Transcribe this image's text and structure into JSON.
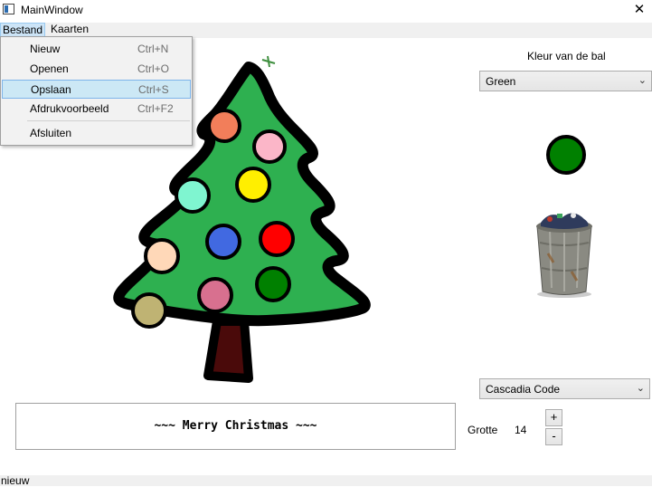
{
  "window": {
    "title": "MainWindow",
    "close_glyph": "✕"
  },
  "menubar": {
    "items": [
      {
        "label": "Bestand"
      },
      {
        "label": "Kaarten"
      }
    ]
  },
  "file_menu": {
    "items": [
      {
        "label": "Nieuw",
        "shortcut": "Ctrl+N"
      },
      {
        "label": "Openen",
        "shortcut": "Ctrl+O"
      },
      {
        "label": "Opslaan",
        "shortcut": "Ctrl+S",
        "highlighted": true
      },
      {
        "label": "Afdrukvoorbeeld",
        "shortcut": "Ctrl+F2"
      },
      {
        "label": "Afsluiten",
        "shortcut": ""
      }
    ]
  },
  "canvas": {
    "tree": {
      "fill": "#2eb050",
      "outline": "#000000",
      "trunk": "#4a0a0a",
      "star": "#3e8e3e"
    },
    "balls": [
      {
        "color": "#f27e5a"
      },
      {
        "color": "#fbb6c8"
      },
      {
        "color": "#7ff5d0"
      },
      {
        "color": "#ffef00"
      },
      {
        "color": "#ffd8b8"
      },
      {
        "color": "#4169e1"
      },
      {
        "color": "#ff0000"
      },
      {
        "color": "#d8708f"
      },
      {
        "color": "#008000"
      },
      {
        "color": "#bfb373"
      }
    ]
  },
  "ball_color": {
    "label": "Kleur van de bal",
    "selected": "Green",
    "swatch": "#008000"
  },
  "trash_icon": "trash-can-icon",
  "font_selector": {
    "selected": "Cascadia Code"
  },
  "greeting": {
    "text": "~~~ Merry Christmas ~~~"
  },
  "font_size": {
    "label": "Grotte",
    "value": "14",
    "plus": "+",
    "minus": "-"
  },
  "status": {
    "text": "nieuw"
  }
}
